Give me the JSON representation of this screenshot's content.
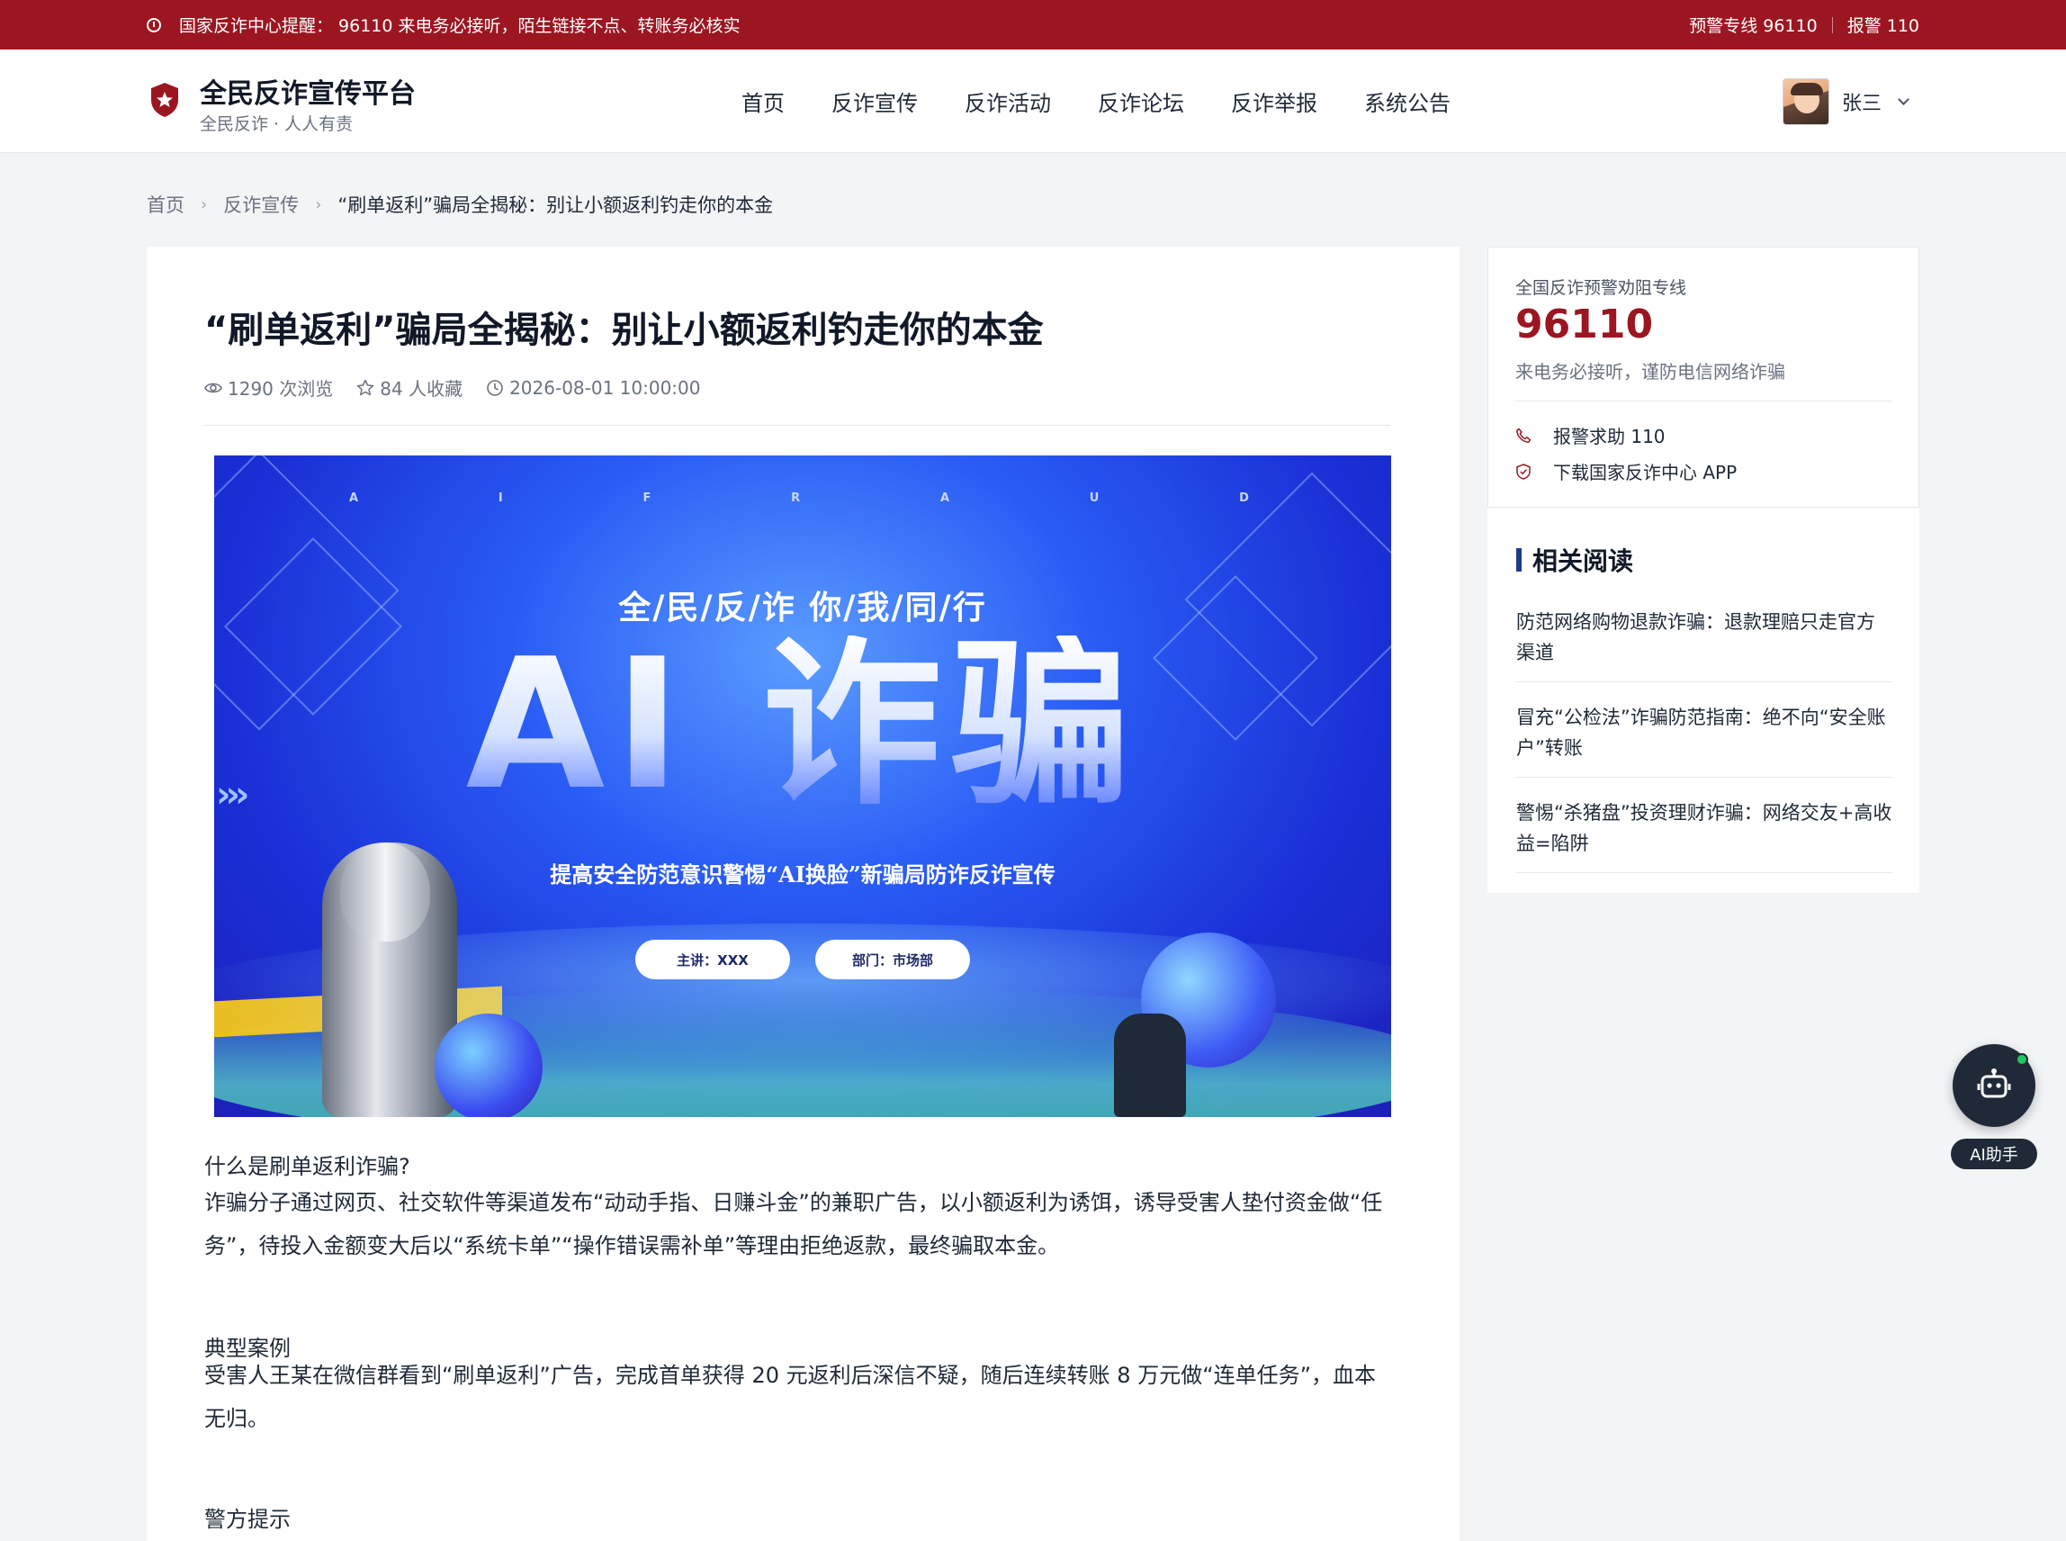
{
  "alert_bar": {
    "notice": "国家反诈中心提醒：  96110 来电务必接听，陌生链接不点、转账务必核实",
    "hotline": "预警专线 96110",
    "police": "报警 110"
  },
  "header": {
    "brand_title": "全民反诈宣传平台",
    "brand_subtitle": "全民反诈 · 人人有责",
    "nav": [
      "首页",
      "反诈宣传",
      "反诈活动",
      "反诈论坛",
      "反诈举报",
      "系统公告"
    ],
    "user_name": "张三"
  },
  "breadcrumb": {
    "home": "首页",
    "section": "反诈宣传",
    "current": "“刷单返利”骗局全揭秘：别让小额返利钓走你的本金"
  },
  "article": {
    "title": "“刷单返利”骗局全揭秘：别让小额返利钓走你的本金",
    "views": "1290 次浏览",
    "favorites": "84 人收藏",
    "date": "2026-08-01 10:00:00",
    "banner": {
      "letters": [
        "A",
        "I",
        "F",
        "R",
        "A",
        "U",
        "D"
      ],
      "slogan": "全/民/反/诈  你/我/同/行",
      "headline": "AI 诈骗",
      "subheadline": "提高安全防范意识警惕“AI换脸”新骗局防诈反诈宣传",
      "pill_speaker": "主讲：XXX",
      "pill_dept": "部门：市场部"
    },
    "q1": "什么是刷单返利诈骗?",
    "p1": "诈骗分子通过网页、社交软件等渠道发布“动动手指、日赚斗金”的兼职广告，以小额返利为诱饵，诱导受害人垫付资金做“任务”，待投入金额变大后以“系统卡单”“操作错误需补单”等理由拒绝返款，最终骗取本金。",
    "h2": "典型案例",
    "p2": "受害人王某在微信群看到“刷单返利”广告，完成首单获得 20 元返利后深信不疑，随后连续转账 8 万元做“连单任务”，血本无归。",
    "h3": "警方提示"
  },
  "sidebar": {
    "label": "全国反诈预警劝阻专线",
    "number": "96110",
    "note": "来电务必接听，谨防电信网络诈骗",
    "link_police": "报警求助 110",
    "link_app": "下载国家反诈中心 APP",
    "related_title": "相关阅读",
    "related": [
      "防范网络购物退款诈骗：退款理赔只走官方渠道",
      "冒充“公检法”诈骗防范指南：绝不向“安全账户”转账",
      "警惕“杀猪盘”投资理财诈骗：网络交友+高收益=陷阱"
    ]
  },
  "ai_assistant": {
    "label": "AI助手"
  },
  "colors": {
    "brand_red": "#9b1621",
    "accent_navy": "#1e3a8a",
    "ai_dark": "#1f2937",
    "online_green": "#22c55e"
  }
}
